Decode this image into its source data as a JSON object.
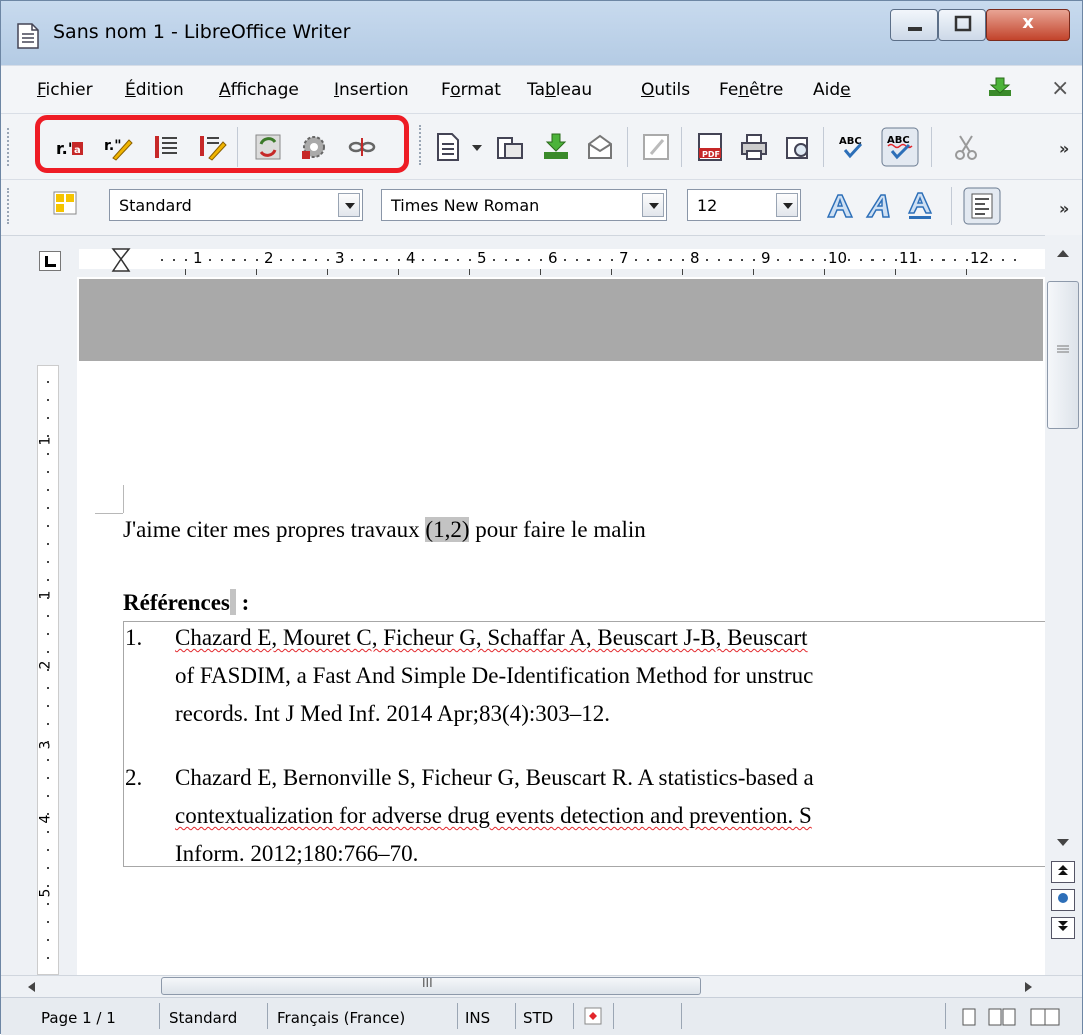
{
  "window": {
    "title": "Sans nom 1 - LibreOffice Writer",
    "close_glyph": "x"
  },
  "menu": [
    {
      "label": "Fichier",
      "u": "F"
    },
    {
      "label": "Édition",
      "u": "É"
    },
    {
      "label": "Affichage",
      "u": "A"
    },
    {
      "label": "Insertion",
      "u": "I"
    },
    {
      "label": "Format",
      "u": "o"
    },
    {
      "label": "Tableau",
      "u": "b"
    },
    {
      "label": "Outils",
      "u": "O"
    },
    {
      "label": "Fenêtre",
      "u": "n"
    },
    {
      "label": "Aide",
      "u": "e"
    }
  ],
  "menu_close": "×",
  "toolbar": {
    "more_glyph": "»",
    "highlight_color": "#ee1c25",
    "zotero_icons": [
      "insert-citation-icon",
      "edit-citation-icon",
      "insert-bibliography-icon",
      "edit-bibliography-icon",
      "refresh-icon",
      "document-preferences-icon",
      "unlink-citations-icon"
    ],
    "standard_icons": [
      "new-document-icon",
      "open-icon",
      "save-icon",
      "email-icon",
      "edit-mode-icon",
      "export-pdf-icon",
      "print-icon",
      "print-preview-icon",
      "spellcheck-icon",
      "autospellcheck-icon",
      "cut-icon"
    ]
  },
  "formatting": {
    "style": "Standard",
    "font": "Times New Roman",
    "size": "12"
  },
  "ruler": {
    "numbers": [
      "1",
      "2",
      "3",
      "4",
      "5",
      "6",
      "7",
      "8",
      "9",
      "10",
      "11",
      "12"
    ],
    "vertical_numbers": [
      "1",
      "1",
      "2",
      "3",
      "4",
      "5"
    ]
  },
  "document": {
    "line1_before": "J'aime citer mes propres travaux ",
    "line1_field": "(1,2)",
    "line1_after": " pour faire le malin",
    "references_heading": "Références",
    "references_colon": " :",
    "ref1_num": "1.",
    "ref1_line1": "Chazard E, Mouret C, Ficheur G, Schaffar A, Beuscart J-B, Beuscart",
    "ref1_line2": "of FASDIM, a Fast And Simple De-Identification Method for unstruc",
    "ref1_line3": "records. Int J Med Inf. 2014 Apr;83(4):303–12.",
    "ref2_num": "2.",
    "ref2_line1": "Chazard E, Bernonville S, Ficheur G, Beuscart R. A statistics-based a",
    "ref2_line2": "contextualization for adverse drug events detection and prevention. S",
    "ref2_line3": "Inform. 2012;180:766–70."
  },
  "statusbar": {
    "page": "Page 1 / 1",
    "style": "Standard",
    "language": "Français (France)",
    "insert_mode": "INS",
    "selection_mode": "STD"
  },
  "hscroll_mark": "III"
}
